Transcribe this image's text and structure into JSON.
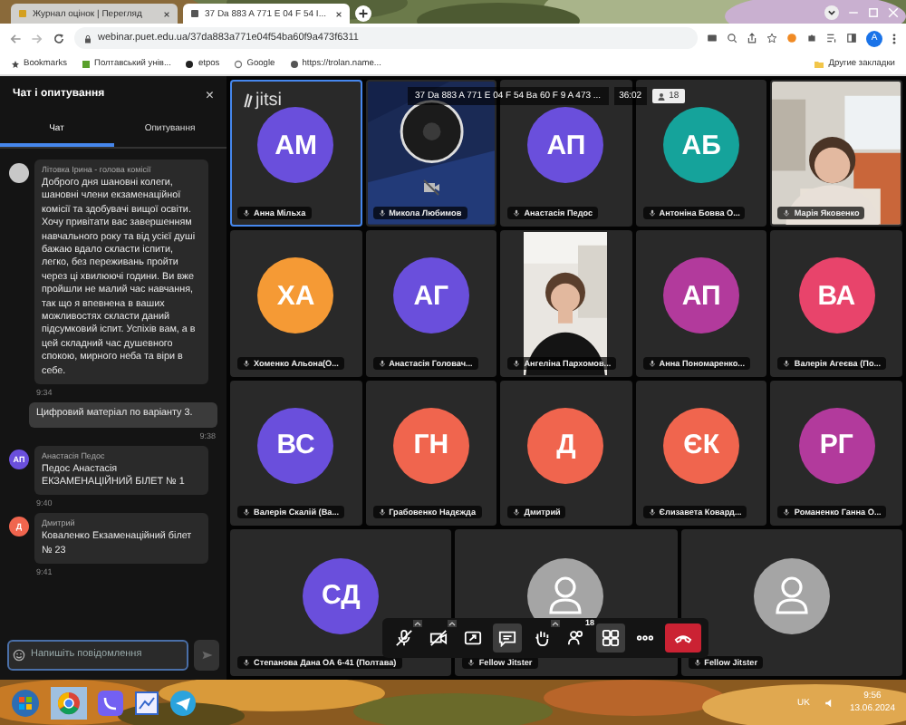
{
  "browser": {
    "tabs": [
      {
        "title": "Журнал оцінок | Перегляд",
        "selected": false
      },
      {
        "title": "37 Da 883 A 771 E 04 F 54 I...",
        "selected": true
      }
    ],
    "url": "webinar.puet.edu.ua/37da883a771e04f54ba60f9a473f6311",
    "profile_initial": "A",
    "bookmarks": [
      "Bookmarks",
      "Полтавський унів...",
      "etpos",
      "Google",
      "https://trolan.name..."
    ],
    "other_bookmarks": "Другие закладки"
  },
  "chat": {
    "title": "Чат і опитування",
    "close": "×",
    "tabs": [
      {
        "label": "Чат",
        "selected": true
      },
      {
        "label": "Опитування",
        "selected": false
      }
    ],
    "messages": [
      {
        "kind": "incoming",
        "color": "#c8c8c8",
        "author": "Літовка Ірина - голова комісії",
        "text": "Доброго дня шановні колеги, шановні члени екзаменаційної комісії та здобувачі вищої освіти. Хочу привітати вас завершенням навчального року та від усієї душі бажаю вдало скласти іспити, легко, без переживань пройти через ці хвилюючі години. Ви вже пройшли не малий час навчання, так що я впевнена в ваших можливостях скласти даний підсумковий іспит. Успіхів вам, а в цей складний час душевного спокою, мирного неба та віри в себе.",
        "time": "9:34"
      },
      {
        "kind": "own",
        "text": "Цифровий матеріал по варіанту 3.",
        "time": "9:38"
      },
      {
        "kind": "incoming",
        "initials": "АП",
        "color": "#6a4fdc",
        "author": "Анастасія Педос",
        "text": "Педос Анастасія ЕКЗАМЕНАЦІЙНИЙ БІЛЕТ № 1",
        "time": "9:40"
      },
      {
        "kind": "incoming",
        "initials": "Д",
        "color": "#f0654e",
        "author": "Дмитрий",
        "text": "Коваленко Екзаменаційний білет № 23",
        "time": "9:41"
      }
    ],
    "placeholder": "Напишіть повідомлення"
  },
  "meeting": {
    "logo_text": "jitsi",
    "room_name": "37 Da 883 A 771 E 04 F 54 Ba 60 F 9 A 473 ...",
    "timer": "36:02",
    "participant_count": "18",
    "tiles": [
      {
        "kind": "avatar",
        "initials": "АМ",
        "color": "#6a4fdc",
        "name": "Анна Мільха",
        "selected": true
      },
      {
        "kind": "screen",
        "name": "Микола Любимов",
        "selected": false
      },
      {
        "kind": "avatar",
        "initials": "АП",
        "color": "#6a4fdc",
        "name": "Анастасія Педос",
        "selected": false
      },
      {
        "kind": "avatar",
        "initials": "АБ",
        "color": "#15a39b",
        "name": "Антоніна Бовва О...",
        "selected": false
      },
      {
        "kind": "video",
        "name": "Марія Яковенко",
        "selected": false
      },
      {
        "kind": "avatar",
        "initials": "ХА",
        "color": "#f59a35",
        "name": "Хоменко Альона(О...",
        "selected": false
      },
      {
        "kind": "avatar",
        "initials": "АГ",
        "color": "#6a4fdc",
        "name": "Анастасія Головач...",
        "selected": false
      },
      {
        "kind": "portrait_video",
        "name": "Ангеліна Пархомов...",
        "selected": false
      },
      {
        "kind": "avatar",
        "initials": "АП",
        "color": "#b23a9c",
        "name": "Анна Пономаренко...",
        "selected": false
      },
      {
        "kind": "avatar",
        "initials": "ВА",
        "color": "#e8446b",
        "name": "Валерія Агеєва (По...",
        "selected": false
      },
      {
        "kind": "avatar",
        "initials": "ВС",
        "color": "#6a4fdc",
        "name": "Валерія Скалій (Ва...",
        "selected": false
      },
      {
        "kind": "avatar",
        "initials": "ГН",
        "color": "#f0654e",
        "name": "Грабовенко Надєжда",
        "selected": false
      },
      {
        "kind": "avatar",
        "initials": "Д",
        "color": "#f0654e",
        "name": "Дмитрий",
        "selected": false
      },
      {
        "kind": "avatar",
        "initials": "ЄК",
        "color": "#f0654e",
        "name": "Єлизавета Ковард...",
        "selected": false
      },
      {
        "kind": "avatar",
        "initials": "РГ",
        "color": "#b23a9c",
        "name": "Романенко Ганна О...",
        "selected": false
      },
      {
        "kind": "avatar",
        "initials": "СД",
        "color": "#6a4fdc",
        "name": "Степанова Дана ОА 6-41 (Полтава)",
        "selected": false
      },
      {
        "kind": "placeholder",
        "name": "Fellow Jitster",
        "selected": false
      },
      {
        "kind": "placeholder",
        "name": "Fellow Jitster",
        "selected": false
      }
    ],
    "toolbar": [
      {
        "kind": "mic",
        "has_menu": true,
        "selected": false
      },
      {
        "kind": "camera",
        "has_menu": true,
        "selected": false
      },
      {
        "kind": "share",
        "has_menu": false,
        "selected": false
      },
      {
        "kind": "chat",
        "has_menu": false,
        "selected": true
      },
      {
        "kind": "hand",
        "has_menu": true,
        "selected": false
      },
      {
        "kind": "participants",
        "has_menu": false,
        "selected": false,
        "badge": "18"
      },
      {
        "kind": "tiles",
        "has_menu": false,
        "selected": true
      },
      {
        "kind": "more",
        "has_menu": false,
        "selected": false
      },
      {
        "kind": "hangup",
        "has_menu": false,
        "selected": false
      }
    ]
  },
  "taskbar": {
    "language": "UK",
    "time": "9:56",
    "date": "13.06.2024"
  }
}
